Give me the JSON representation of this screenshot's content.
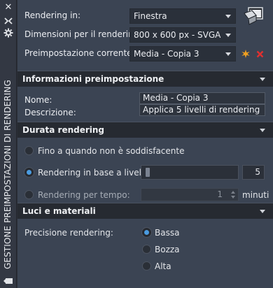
{
  "palette_title": "GESTIONE PREIMPOSTAZIONI DI RENDERING",
  "top": {
    "render_in_label": "Rendering in:",
    "render_in_value": "Finestra",
    "size_label": "Dimensioni per il rendering:",
    "size_value": "800 x 600 px - SVGA",
    "preset_label": "Preimpostazione corrente:",
    "preset_value": "Media - Copia 3"
  },
  "info": {
    "header": "Informazioni preimpostazione",
    "name_label": "Nome:",
    "name_value": "Media - Copia 3",
    "desc_label": "Descrizione:",
    "desc_value": "Applica 5 livelli di rendering"
  },
  "duration": {
    "header": "Durata rendering",
    "opt_until": "Fino a quando non è soddisfacente",
    "opt_level": "Rendering in base a livello:",
    "level_value": "5",
    "level_fraction": 0.0,
    "opt_time": "Rendering per tempo:",
    "time_value": "1",
    "time_unit": "minuti",
    "selected": "level"
  },
  "lights": {
    "header": "Luci e materiali",
    "precision_label": "Precisione rendering:",
    "options": [
      "Bassa",
      "Bozza",
      "Alta"
    ],
    "selected": "Bassa"
  },
  "colors": {
    "accent": "#4a9be0",
    "new_icon": "#f0a020",
    "delete_icon": "#e03030"
  }
}
